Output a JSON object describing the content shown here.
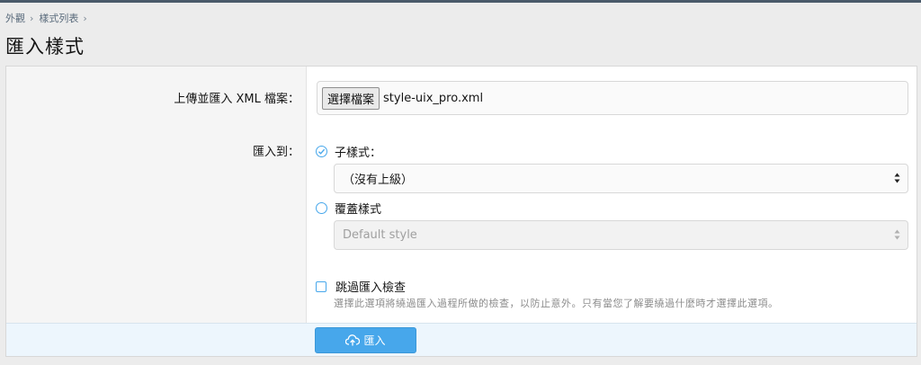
{
  "breadcrumb": {
    "items": [
      "外觀",
      "樣式列表"
    ],
    "separator": "›"
  },
  "page_title": "匯入樣式",
  "form": {
    "upload_label": "上傳並匯入 XML 檔案：",
    "file_button": "選擇檔案",
    "file_name": "style-uix_pro.xml",
    "import_to_label": "匯入到：",
    "child_style_label": "子樣式：",
    "child_style_selected": "true",
    "parent_select_value": "（沒有上級）",
    "overwrite_label": "覆蓋樣式",
    "overwrite_select_value": "Default style",
    "skip_check_label": "跳過匯入檢查",
    "skip_check_hint": "選擇此選項將繞過匯入過程所做的檢查，以防止意外。只有當您了解要繞過什麼時才選擇此選項。"
  },
  "footer": {
    "submit_label": "匯入",
    "submit_icon": "upload-icon"
  },
  "colors": {
    "accent": "#47a7eb",
    "footer_bg": "#edf6fd",
    "label_col_bg": "#f5f5f5"
  }
}
